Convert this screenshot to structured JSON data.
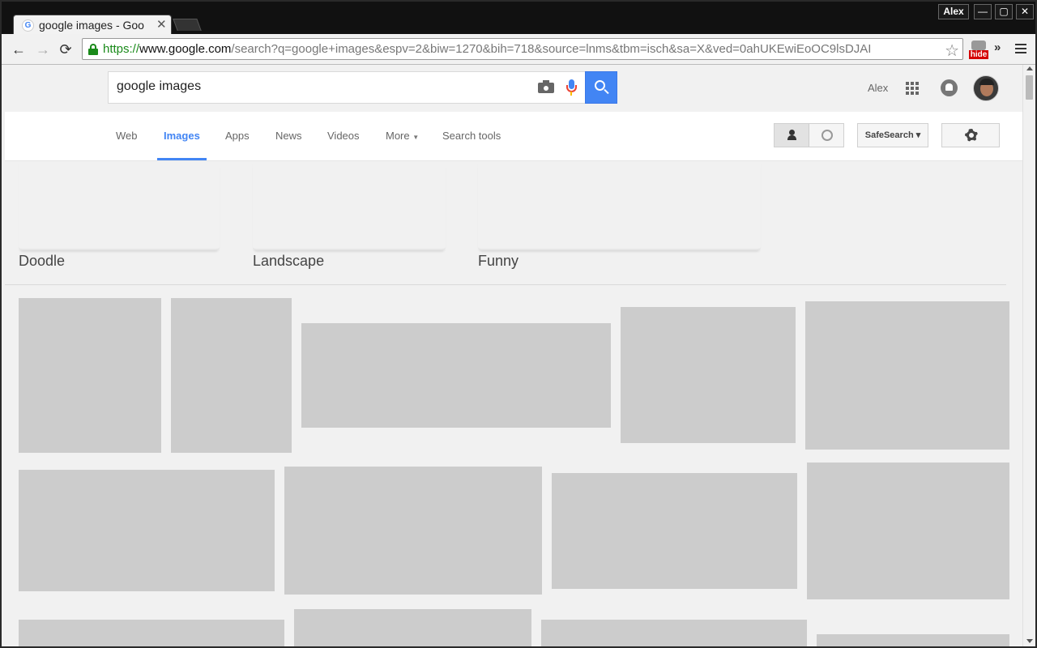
{
  "browser": {
    "tab_title": "google images - Goo",
    "tab_close": "✕",
    "favicon_letter": "G",
    "profile_name": "Alex",
    "window_controls": {
      "minimize": "—",
      "maximize": "▢",
      "close": "✕"
    },
    "nav": {
      "back": "←",
      "forward": "→",
      "reload": "⟳"
    },
    "url": {
      "scheme": "https://",
      "domain": "www.google.com",
      "path": "/search?q=google+images&espv=2&biw=1270&bih=718&source=lnms&tbm=isch&sa=X&ved=0ahUKEwiEoOC9lsDJAI"
    },
    "bookmark_star": "☆",
    "extension_badge": "hide",
    "overflow_chevron": "»"
  },
  "google": {
    "query": "google images",
    "user_name": "Alex",
    "tabs": [
      {
        "label": "Web"
      },
      {
        "label": "Images",
        "active": true
      },
      {
        "label": "Apps"
      },
      {
        "label": "News"
      },
      {
        "label": "Videos"
      },
      {
        "label": "More",
        "dropdown": true
      },
      {
        "label": "Search tools"
      }
    ],
    "more_caret": "▼",
    "safesearch_label": "SafeSearch",
    "safesearch_caret": "▾",
    "topics": [
      {
        "label": "Doodle"
      },
      {
        "label": "Landscape"
      },
      {
        "label": "Funny"
      }
    ],
    "placeholder_color": "#cccccc",
    "accent_color": "#4285f4"
  }
}
